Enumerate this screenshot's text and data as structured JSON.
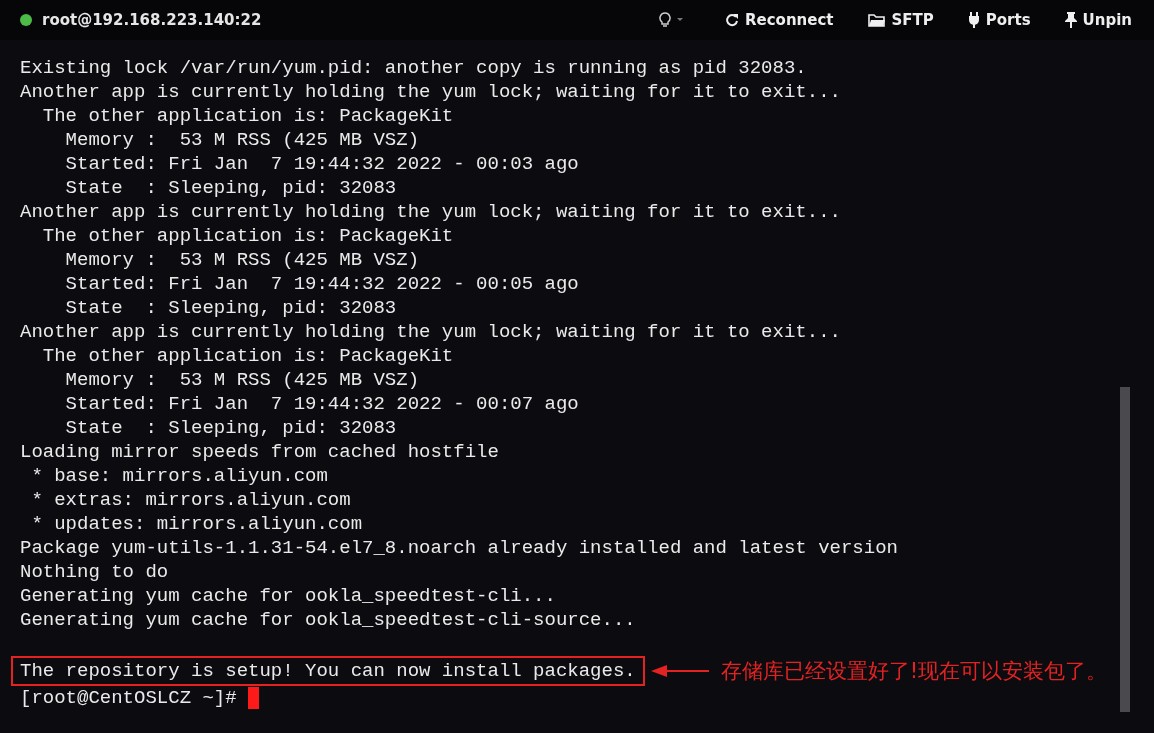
{
  "header": {
    "host": "root@192.168.223.140:22",
    "connected": true,
    "actions": [
      {
        "kind": "reconnect",
        "label": "Reconnect"
      },
      {
        "kind": "sftp",
        "label": "SFTP"
      },
      {
        "kind": "ports",
        "label": "Ports"
      },
      {
        "kind": "unpin",
        "label": "Unpin"
      }
    ]
  },
  "terminal": {
    "lines": [
      "Existing lock /var/run/yum.pid: another copy is running as pid 32083.",
      "Another app is currently holding the yum lock; waiting for it to exit...",
      "  The other application is: PackageKit",
      "    Memory :  53 M RSS (425 MB VSZ)",
      "    Started: Fri Jan  7 19:44:32 2022 - 00:03 ago",
      "    State  : Sleeping, pid: 32083",
      "Another app is currently holding the yum lock; waiting for it to exit...",
      "  The other application is: PackageKit",
      "    Memory :  53 M RSS (425 MB VSZ)",
      "    Started: Fri Jan  7 19:44:32 2022 - 00:05 ago",
      "    State  : Sleeping, pid: 32083",
      "Another app is currently holding the yum lock; waiting for it to exit...",
      "  The other application is: PackageKit",
      "    Memory :  53 M RSS (425 MB VSZ)",
      "    Started: Fri Jan  7 19:44:32 2022 - 00:07 ago",
      "    State  : Sleeping, pid: 32083",
      "Loading mirror speeds from cached hostfile",
      " * base: mirrors.aliyun.com",
      " * extras: mirrors.aliyun.com",
      " * updates: mirrors.aliyun.com",
      "Package yum-utils-1.1.31-54.el7_8.noarch already installed and latest version",
      "Nothing to do",
      "Generating yum cache for ookla_speedtest-cli...",
      "Generating yum cache for ookla_speedtest-cli-source..."
    ],
    "highlighted_line": "The repository is setup! You can now install packages.",
    "annotation": "存储库已经设置好了!现在可以安装包了。",
    "prompt": "[root@CentOSLCZ ~]#"
  }
}
